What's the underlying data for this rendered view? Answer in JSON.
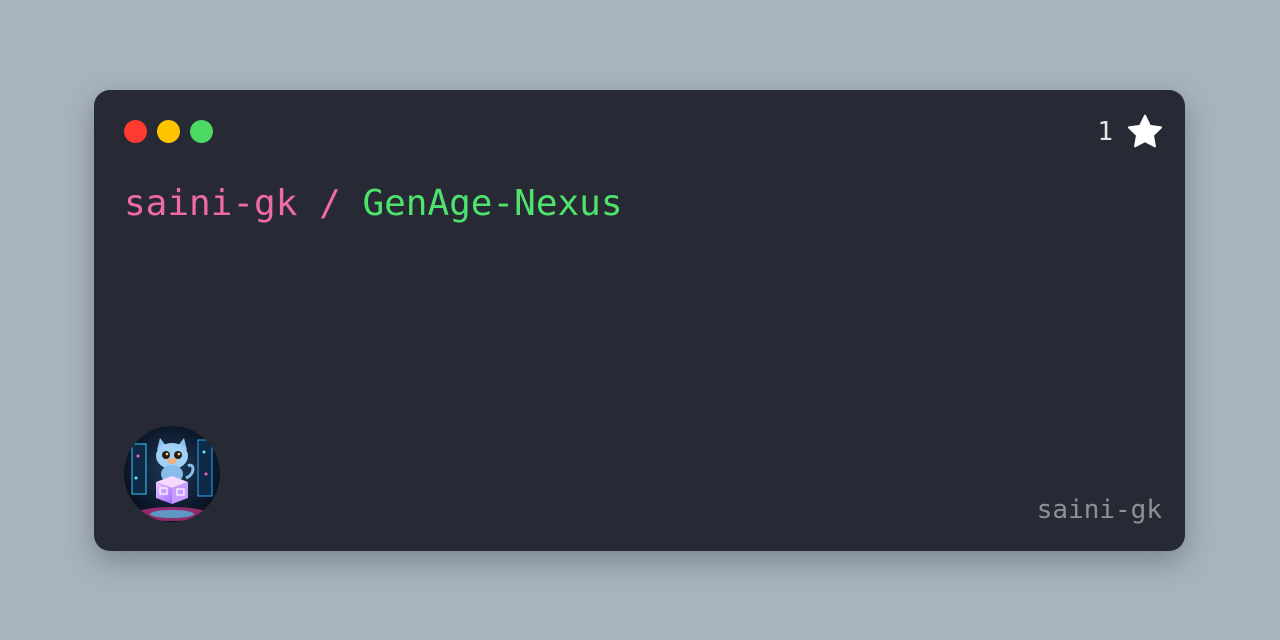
{
  "window": {
    "controls": [
      "close",
      "minimize",
      "maximize"
    ],
    "colors": {
      "background": "#272935",
      "close": "#ff3b30",
      "minimize": "#ffc400",
      "maximize": "#4cd964"
    }
  },
  "repo": {
    "owner": "saini-gk",
    "separator": "/",
    "name": "GenAge-Nexus",
    "owner_color": "#f06aa8",
    "name_color": "#4ee36d"
  },
  "stars": {
    "count": "1",
    "icon": "star-icon"
  },
  "footer": {
    "avatar_icon": "cyber-cat-avatar",
    "username": "saini-gk"
  }
}
